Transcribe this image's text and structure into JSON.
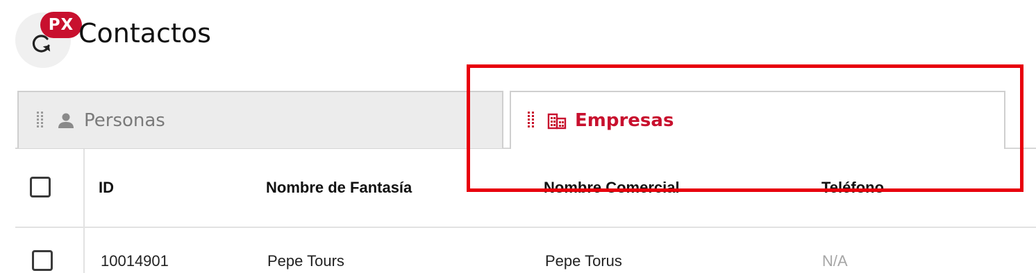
{
  "header": {
    "badge": "PX",
    "title": "Contactos",
    "reload_icon": "reload-icon"
  },
  "tabs": [
    {
      "label": "Personas",
      "icon": "person-icon",
      "active": false
    },
    {
      "label": "Empresas",
      "icon": "building-icon",
      "active": true
    }
  ],
  "table": {
    "columns": [
      "ID",
      "Nombre de Fantasía",
      "Nombre Comercial",
      "Teléfono"
    ],
    "rows": [
      [
        "10014901",
        "Pepe Tours",
        "Pepe Torus",
        "N/A"
      ]
    ]
  },
  "colors": {
    "accent": "#c8102e",
    "highlight": "#e8000b",
    "inactive_tab_bg": "#ececec",
    "muted_text": "#a6a6a6"
  }
}
